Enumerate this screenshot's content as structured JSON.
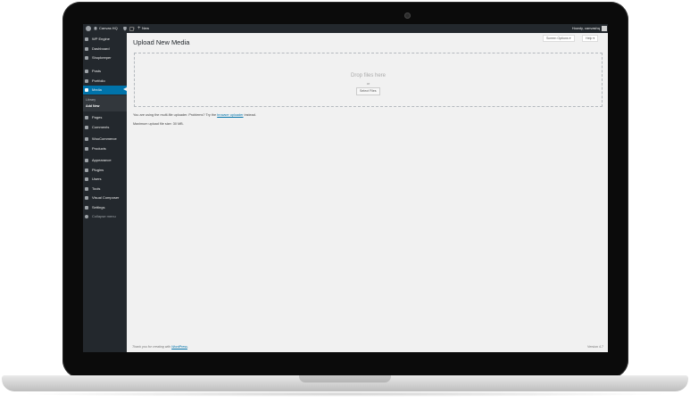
{
  "admin_bar": {
    "site_name": "Canvas HQ",
    "comments_count": "0",
    "new_label": "New",
    "greeting": "Howdy, canvashq"
  },
  "sidebar": {
    "items": [
      {
        "label": "WP Engine",
        "icon": "wp-engine-icon"
      },
      {
        "label": "Dashboard",
        "icon": "dashboard-icon"
      },
      {
        "label": "Shopkeeper",
        "icon": "shopkeeper-icon"
      },
      {
        "label": "Posts",
        "icon": "pushpin-icon"
      },
      {
        "label": "Portfolio",
        "icon": "portfolio-icon"
      },
      {
        "label": "Media",
        "icon": "media-icon",
        "active": true
      },
      {
        "label": "Pages",
        "icon": "pages-icon"
      },
      {
        "label": "Comments",
        "icon": "comments-icon"
      },
      {
        "label": "WooCommerce",
        "icon": "woocommerce-icon"
      },
      {
        "label": "Products",
        "icon": "products-icon"
      },
      {
        "label": "Appearance",
        "icon": "appearance-icon"
      },
      {
        "label": "Plugins",
        "icon": "plugins-icon"
      },
      {
        "label": "Users",
        "icon": "users-icon"
      },
      {
        "label": "Tools",
        "icon": "tools-icon"
      },
      {
        "label": "Visual Composer",
        "icon": "visual-composer-icon"
      },
      {
        "label": "Settings",
        "icon": "settings-icon"
      },
      {
        "label": "Collapse menu",
        "icon": "collapse-icon"
      }
    ],
    "submenu": {
      "library": "Library",
      "add_new": "Add New"
    }
  },
  "header": {
    "screen_options": "Screen Options ▾",
    "help": "Help ▾"
  },
  "main": {
    "title": "Upload New Media",
    "drop_title": "Drop files here",
    "drop_or": "or",
    "select_files": "Select Files",
    "uploader_text_before": "You are using the multi-file uploader. Problems? Try the ",
    "uploader_link": "browser uploader",
    "uploader_text_after": " instead.",
    "max_size": "Maximum upload file size: 30 MB."
  },
  "footer": {
    "thanks_before": "Thank you for creating with ",
    "wordpress_link": "WordPress",
    "thanks_after": ".",
    "version": "Version 4.7"
  },
  "colors": {
    "admin_bar": "#23282d",
    "sidebar": "#23282d",
    "active_item": "#0073aa",
    "content_bg": "#f1f1f1",
    "link": "#0073aa"
  }
}
